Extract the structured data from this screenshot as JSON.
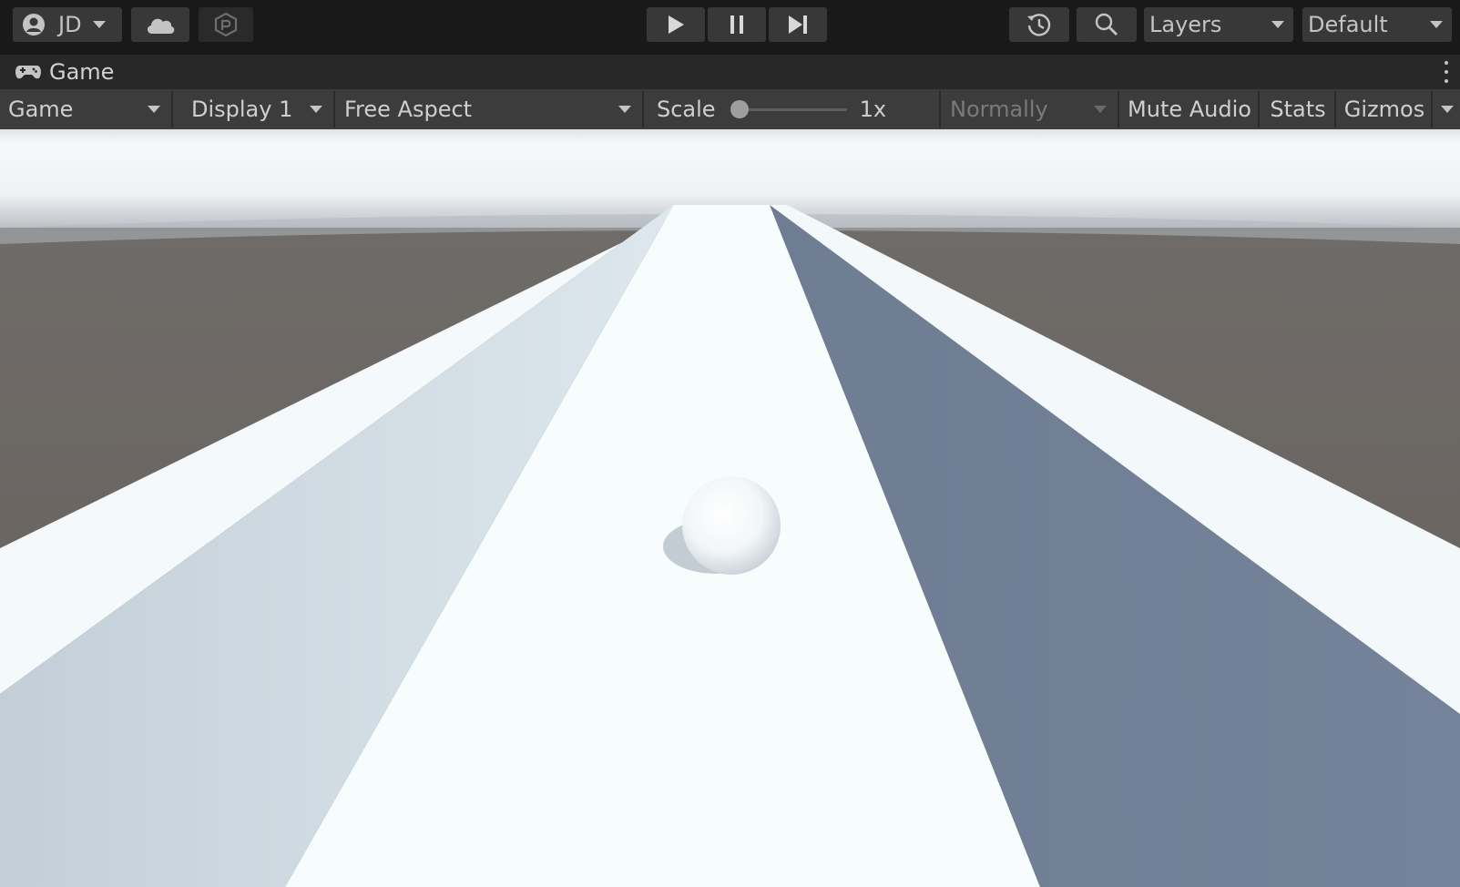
{
  "toolbar": {
    "account": {
      "initials": "JD",
      "icon": "user-circle-icon"
    },
    "cloud_icon": "cloud-icon",
    "collab_icon": "package-icon",
    "play_icon": "play-icon",
    "pause_icon": "pause-icon",
    "step_icon": "step-icon",
    "history_icon": "history-icon",
    "search_icon": "search-icon",
    "layers_label": "Layers",
    "layout_label": "Default"
  },
  "tab": {
    "icon": "gamepad-icon",
    "label": "Game"
  },
  "game_view_bar": {
    "view_select": "Game",
    "display_select": "Display 1",
    "aspect_select": "Free Aspect",
    "scale_label": "Scale",
    "scale_value": "1x",
    "scale_fraction": 0,
    "play_mode_select": "Normally",
    "mute_audio": "Mute Audio",
    "stats": "Stats",
    "gizmos": "Gizmos"
  },
  "colors": {
    "toolbar_bg": "#191919",
    "button_bg": "#383838",
    "gv_bar_bg": "#3c3c3c",
    "sky": "#f3f8fa",
    "ground": "#6b6662",
    "track_floor": "#f7fcfd",
    "left_wall_inner": "#c8d4dc",
    "right_wall_inner": "#718096"
  }
}
